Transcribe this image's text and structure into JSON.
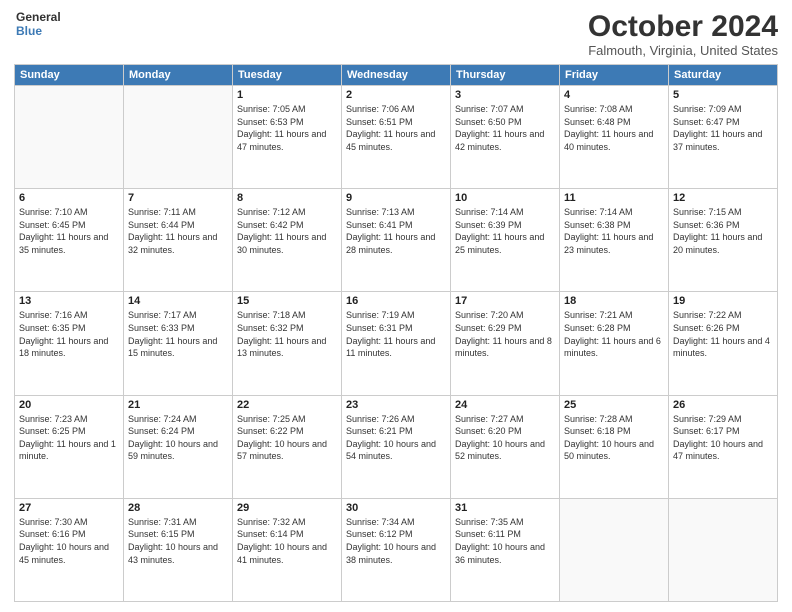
{
  "header": {
    "logo_general": "General",
    "logo_blue": "Blue",
    "month_title": "October 2024",
    "location": "Falmouth, Virginia, United States"
  },
  "weekdays": [
    "Sunday",
    "Monday",
    "Tuesday",
    "Wednesday",
    "Thursday",
    "Friday",
    "Saturday"
  ],
  "weeks": [
    [
      {
        "day": "",
        "info": ""
      },
      {
        "day": "",
        "info": ""
      },
      {
        "day": "1",
        "info": "Sunrise: 7:05 AM\nSunset: 6:53 PM\nDaylight: 11 hours and 47 minutes."
      },
      {
        "day": "2",
        "info": "Sunrise: 7:06 AM\nSunset: 6:51 PM\nDaylight: 11 hours and 45 minutes."
      },
      {
        "day": "3",
        "info": "Sunrise: 7:07 AM\nSunset: 6:50 PM\nDaylight: 11 hours and 42 minutes."
      },
      {
        "day": "4",
        "info": "Sunrise: 7:08 AM\nSunset: 6:48 PM\nDaylight: 11 hours and 40 minutes."
      },
      {
        "day": "5",
        "info": "Sunrise: 7:09 AM\nSunset: 6:47 PM\nDaylight: 11 hours and 37 minutes."
      }
    ],
    [
      {
        "day": "6",
        "info": "Sunrise: 7:10 AM\nSunset: 6:45 PM\nDaylight: 11 hours and 35 minutes."
      },
      {
        "day": "7",
        "info": "Sunrise: 7:11 AM\nSunset: 6:44 PM\nDaylight: 11 hours and 32 minutes."
      },
      {
        "day": "8",
        "info": "Sunrise: 7:12 AM\nSunset: 6:42 PM\nDaylight: 11 hours and 30 minutes."
      },
      {
        "day": "9",
        "info": "Sunrise: 7:13 AM\nSunset: 6:41 PM\nDaylight: 11 hours and 28 minutes."
      },
      {
        "day": "10",
        "info": "Sunrise: 7:14 AM\nSunset: 6:39 PM\nDaylight: 11 hours and 25 minutes."
      },
      {
        "day": "11",
        "info": "Sunrise: 7:14 AM\nSunset: 6:38 PM\nDaylight: 11 hours and 23 minutes."
      },
      {
        "day": "12",
        "info": "Sunrise: 7:15 AM\nSunset: 6:36 PM\nDaylight: 11 hours and 20 minutes."
      }
    ],
    [
      {
        "day": "13",
        "info": "Sunrise: 7:16 AM\nSunset: 6:35 PM\nDaylight: 11 hours and 18 minutes."
      },
      {
        "day": "14",
        "info": "Sunrise: 7:17 AM\nSunset: 6:33 PM\nDaylight: 11 hours and 15 minutes."
      },
      {
        "day": "15",
        "info": "Sunrise: 7:18 AM\nSunset: 6:32 PM\nDaylight: 11 hours and 13 minutes."
      },
      {
        "day": "16",
        "info": "Sunrise: 7:19 AM\nSunset: 6:31 PM\nDaylight: 11 hours and 11 minutes."
      },
      {
        "day": "17",
        "info": "Sunrise: 7:20 AM\nSunset: 6:29 PM\nDaylight: 11 hours and 8 minutes."
      },
      {
        "day": "18",
        "info": "Sunrise: 7:21 AM\nSunset: 6:28 PM\nDaylight: 11 hours and 6 minutes."
      },
      {
        "day": "19",
        "info": "Sunrise: 7:22 AM\nSunset: 6:26 PM\nDaylight: 11 hours and 4 minutes."
      }
    ],
    [
      {
        "day": "20",
        "info": "Sunrise: 7:23 AM\nSunset: 6:25 PM\nDaylight: 11 hours and 1 minute."
      },
      {
        "day": "21",
        "info": "Sunrise: 7:24 AM\nSunset: 6:24 PM\nDaylight: 10 hours and 59 minutes."
      },
      {
        "day": "22",
        "info": "Sunrise: 7:25 AM\nSunset: 6:22 PM\nDaylight: 10 hours and 57 minutes."
      },
      {
        "day": "23",
        "info": "Sunrise: 7:26 AM\nSunset: 6:21 PM\nDaylight: 10 hours and 54 minutes."
      },
      {
        "day": "24",
        "info": "Sunrise: 7:27 AM\nSunset: 6:20 PM\nDaylight: 10 hours and 52 minutes."
      },
      {
        "day": "25",
        "info": "Sunrise: 7:28 AM\nSunset: 6:18 PM\nDaylight: 10 hours and 50 minutes."
      },
      {
        "day": "26",
        "info": "Sunrise: 7:29 AM\nSunset: 6:17 PM\nDaylight: 10 hours and 47 minutes."
      }
    ],
    [
      {
        "day": "27",
        "info": "Sunrise: 7:30 AM\nSunset: 6:16 PM\nDaylight: 10 hours and 45 minutes."
      },
      {
        "day": "28",
        "info": "Sunrise: 7:31 AM\nSunset: 6:15 PM\nDaylight: 10 hours and 43 minutes."
      },
      {
        "day": "29",
        "info": "Sunrise: 7:32 AM\nSunset: 6:14 PM\nDaylight: 10 hours and 41 minutes."
      },
      {
        "day": "30",
        "info": "Sunrise: 7:34 AM\nSunset: 6:12 PM\nDaylight: 10 hours and 38 minutes."
      },
      {
        "day": "31",
        "info": "Sunrise: 7:35 AM\nSunset: 6:11 PM\nDaylight: 10 hours and 36 minutes."
      },
      {
        "day": "",
        "info": ""
      },
      {
        "day": "",
        "info": ""
      }
    ]
  ]
}
